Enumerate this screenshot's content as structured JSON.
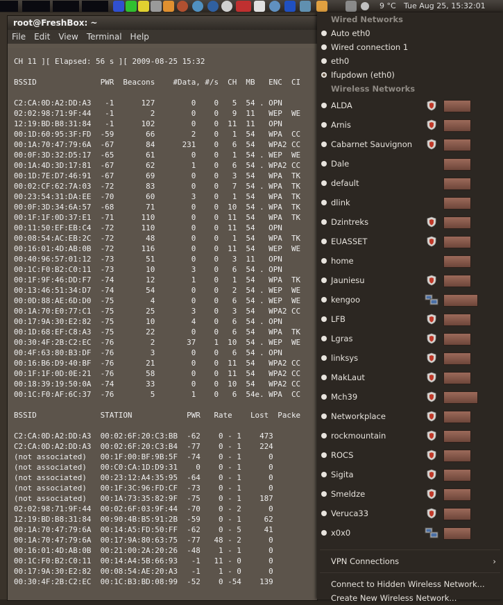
{
  "top_panel": {
    "weather": "9 °C",
    "clock": "Tue Aug 25, 15:32:01"
  },
  "terminal": {
    "title": "root@FreshBox: ~",
    "menu": [
      "File",
      "Edit",
      "View",
      "Terminal",
      "Help"
    ],
    "content": "CH 11 ][ Elapsed: 56 s ][ 2009-08-25 15:32\n\nBSSID              PWR  Beacons    #Data, #/s  CH  MB   ENC  CI\n\nC2:CA:0D:A2:DD:A3   -1      127        0    0   5  54 . OPN\n02:02:98:71:9F:44   -1        2        0    0   9  11   WEP  WE\n12:19:BD:B8:31:84   -1      102        0    0  11  11   OPN\n00:1D:60:95:3F:FD  -59       66        2    0   1  54   WPA  CC\n00:1A:70:47:79:6A  -67       84      231    0   6  54   WPA2 CC\n00:0F:3D:32:D5:17  -65       61        0    0   1  54 . WEP  WE\n00:1A:4D:3D:17:81  -67       62        1    0   6  54 . WPA2 CC\n00:1D:7E:D7:46:91  -67       69        0    0   3  54   WPA  TK\n00:02:CF:62:7A:03  -72       83        0    0   7  54 . WPA  TK\n00:23:54:31:DA:EE  -70       60        3    0   1  54   WPA  TK\n00:0F:3D:34:6A:57  -68       71        0    0  10  54 . WPA  TK\n00:1F:1F:0D:37:E1  -71      110        0    0  11  54   WPA  TK\n00:11:50:EF:EB:C4  -72      110        0    0  11  54   OPN\n00:08:54:AC:EB:2C  -72       48        0    0   1  54   WPA  TK\n00:16:01:4D:AB:0B  -72      116        0    0  11  54   WEP  WE\n00:40:96:57:01:12  -73       51        0    0   3  11   OPN\n00:1C:F0:B2:C0:11  -73       10        3    0   6  54 . OPN\n00:1F:9F:46:DD:F7  -74       12        1    0   1  54   WPA  TK\n00:13:46:51:34:D7  -74       54        0    0   2  54 . WEP  WE\n00:0D:88:AE:6D:D0  -75        4        0    0   6  54 . WEP  WE\n00:1A:70:E0:77:C1  -75       25        3    0   3  54   WPA2 CC\n00:17:9A:30:E2:82  -75       10        4    0   6  54 . OPN\n00:1D:68:EF:C8:A3  -75       22        0    0   6  54   WPA  TK\n00:30:4F:2B:C2:EC  -76        2       37    1  10  54 . WEP  WE\n00:4F:63:80:B3:DF  -76        3        0    0   6  54 . OPN\n00:16:B6:D9:40:BF  -76       21        0    0  11  54   WPA2 CC\n00:1F:1F:0D:0E:21  -76       58        0    0  11  54   WPA2 CC\n00:18:39:19:50:0A  -74       33        0    0  10  54   WPA2 CC\n00:1C:F0:AF:6C:37  -76        5        1    0   6  54e. WPA  CC\n\nBSSID              STATION            PWR   Rate    Lost  Packe\n\nC2:CA:0D:A2:DD:A3  00:02:6F:20:C3:BB  -62    0 - 1    473\nC2:CA:0D:A2:DD:A3  00:02:6F:20:C3:B4  -77    0 - 1    224\n(not associated)   00:1F:00:BF:9B:5F  -74    0 - 1      0\n(not associated)   00:C0:CA:1D:D9:31    0    0 - 1      0\n(not associated)   00:23:12:A4:35:95  -64    0 - 1      0\n(not associated)   00:1F:3C:96:FD:CF  -73    0 - 1      0\n(not associated)   00:1A:73:35:82:9F  -75    0 - 1    187\n02:02:98:71:9F:44  00:02:6F:03:9F:44  -70    0 - 2      0\n12:19:BD:B8:31:84  00:90:4B:B5:91:2B  -59    0 - 1     62\n00:1A:70:47:79:6A  00:14:A5:FD:50:FF  -62    0 - 5     41\n00:1A:70:47:79:6A  00:17:9A:80:63:75  -77   48 - 2      0\n00:16:01:4D:AB:0B  00:21:00:2A:20:26  -48    1 - 1      0\n00:1C:F0:B2:C0:11  00:14:A4:5B:66:93   -1   11 - 0      0\n00:17:9A:30:E2:82  00:08:54:AE:20:A3   -1    1 - 0      0\n00:30:4F:2B:C2:EC  00:1C:B3:BD:08:99  -52    0 -54    139"
  },
  "network_menu": {
    "wired_header": "Wired Networks",
    "wired": [
      {
        "label": "Auto eth0",
        "selected": false
      },
      {
        "label": "Wired connection 1",
        "selected": false
      },
      {
        "label": "eth0",
        "selected": false
      },
      {
        "label": "Ifupdown (eth0)",
        "selected": true
      }
    ],
    "wireless_header": "Wireless Networks",
    "wireless": [
      {
        "label": "ALDA",
        "icon": "shield",
        "signal": "mid"
      },
      {
        "label": "Arnis",
        "icon": "shield",
        "signal": "mid"
      },
      {
        "label": "Cabarnet Sauvignon",
        "icon": "shield",
        "signal": "low"
      },
      {
        "label": "Dale",
        "icon": "none",
        "signal": "low"
      },
      {
        "label": "default",
        "icon": "none",
        "signal": "low"
      },
      {
        "label": "dlink",
        "icon": "none",
        "signal": "low"
      },
      {
        "label": "Dzintreks",
        "icon": "shield",
        "signal": "low"
      },
      {
        "label": "EUASSET",
        "icon": "shield",
        "signal": "low"
      },
      {
        "label": "home",
        "icon": "none",
        "signal": "low"
      },
      {
        "label": "Jauniesu",
        "icon": "shield",
        "signal": "low"
      },
      {
        "label": "kengoo",
        "icon": "network",
        "signal": "high"
      },
      {
        "label": "LFB",
        "icon": "shield",
        "signal": "low"
      },
      {
        "label": "Lgras",
        "icon": "shield",
        "signal": "low"
      },
      {
        "label": "linksys",
        "icon": "shield",
        "signal": "low"
      },
      {
        "label": "MakLaut",
        "icon": "shield",
        "signal": "low"
      },
      {
        "label": "Mch39",
        "icon": "shield",
        "signal": "high"
      },
      {
        "label": "Networkplace",
        "icon": "shield",
        "signal": "mid"
      },
      {
        "label": "rockmountain",
        "icon": "shield",
        "signal": "mid"
      },
      {
        "label": "ROCS",
        "icon": "shield",
        "signal": "mid"
      },
      {
        "label": "Sigita",
        "icon": "shield",
        "signal": "low"
      },
      {
        "label": "Smeldze",
        "icon": "shield",
        "signal": "mid"
      },
      {
        "label": "Veruca33",
        "icon": "shield",
        "signal": "mid"
      },
      {
        "label": "x0x0",
        "icon": "network",
        "signal": "mid"
      }
    ],
    "vpn_label": "VPN Connections",
    "hidden_label": "Connect to Hidden Wireless Network...",
    "create_label": "Create New Wireless Network..."
  }
}
